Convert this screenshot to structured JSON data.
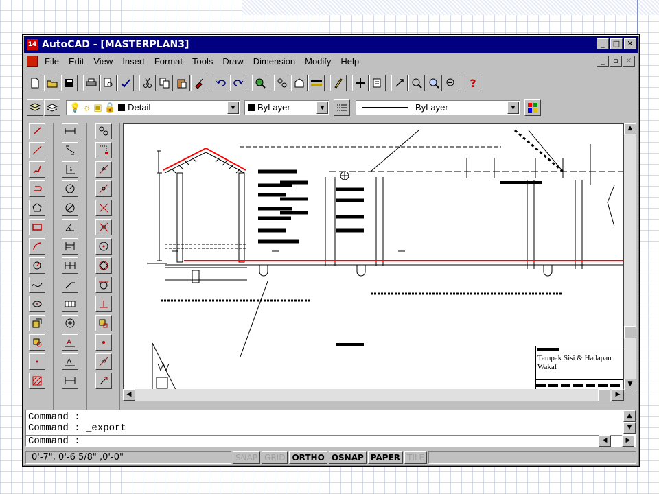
{
  "window": {
    "icon_label": "14",
    "title": "AutoCAD - [MASTERPLAN3]",
    "controls": [
      "_",
      "□",
      "✕"
    ],
    "doc_controls": [
      "_",
      "▫",
      "✕"
    ]
  },
  "menu": {
    "items": [
      "File",
      "Edit",
      "View",
      "Insert",
      "Format",
      "Tools",
      "Draw",
      "Dimension",
      "Modify",
      "Help"
    ]
  },
  "toolbar_standard": {
    "icons": [
      "new-icon",
      "open-icon",
      "save-icon",
      "print-icon",
      "preview-icon",
      "spelling-icon",
      "cut-icon",
      "copy-icon",
      "paste-icon",
      "match-properties-icon",
      "undo-icon",
      "redo-icon",
      "launch-browser-icon",
      "snap-from-icon",
      "tracking-icon",
      "point-filter-icon",
      "draw-pen-icon",
      "ucs-icon",
      "inquiry-icon",
      "redraw-icon",
      "pan-icon",
      "zoom-icon",
      "zoom-window-icon",
      "aerial-view-icon",
      "help-icon"
    ],
    "help_glyph": "?"
  },
  "toolbar_layers": {
    "layer": "Detail",
    "color": "ByLayer",
    "linetype": "ByLayer",
    "color_hex": "#000000"
  },
  "command_line": {
    "lines": [
      "Command :",
      "Command :  _export",
      "Command :"
    ]
  },
  "status": {
    "coordinates": "0'-7\",      0'-6 5/8\" ,0'-0\"",
    "toggles": [
      {
        "label": "SNAP",
        "on": false
      },
      {
        "label": "GRID",
        "on": false
      },
      {
        "label": "ORTHO",
        "on": true
      },
      {
        "label": "OSNAP",
        "on": true
      },
      {
        "label": "PAPER",
        "on": true
      },
      {
        "label": "TILE",
        "on": false
      }
    ]
  },
  "drawing": {
    "title_block": {
      "title_line1": "Tampak Sisi & Hadapan",
      "title_line2": "Wakaf"
    }
  },
  "colors": {
    "titlebar": "#000080",
    "chrome": "#c0c0c0",
    "drawing_red": "#ff0000"
  }
}
